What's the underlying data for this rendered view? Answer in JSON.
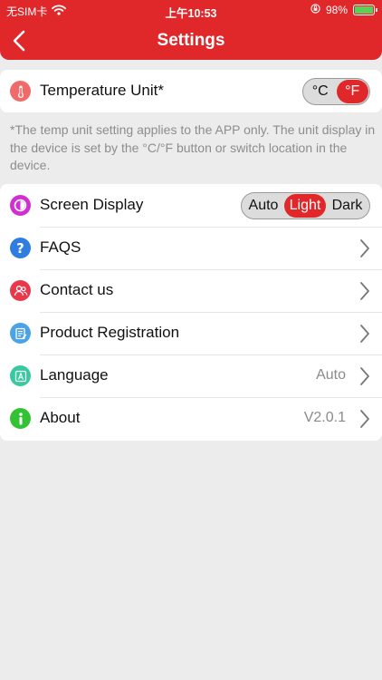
{
  "status_bar": {
    "carrier": "无SIM卡",
    "time": "上午10:53",
    "battery_percent": "98%",
    "battery_level": 0.98
  },
  "nav": {
    "title": "Settings",
    "back_icon": "chevron-left-icon"
  },
  "temperature": {
    "label": "Temperature Unit*",
    "icon": "thermometer-icon",
    "options": [
      "°C",
      "°F"
    ],
    "selected": "°F",
    "note": "*The temp unit setting applies to the APP only. The unit display in the device is set by the °C/°F button or switch location in the device."
  },
  "screen_display": {
    "label": "Screen Display",
    "icon": "brightness-icon",
    "options": [
      "Auto",
      "Light",
      "Dark"
    ],
    "selected": "Light"
  },
  "menu": [
    {
      "label": "FAQS",
      "icon": "question-icon",
      "value": ""
    },
    {
      "label": "Contact us",
      "icon": "contacts-icon",
      "value": ""
    },
    {
      "label": "Product Registration",
      "icon": "registration-icon",
      "value": ""
    },
    {
      "label": "Language",
      "icon": "language-icon",
      "value": "Auto"
    },
    {
      "label": "About",
      "icon": "info-icon",
      "value": "V2.0.1"
    }
  ],
  "colors": {
    "accent": "#e0282b",
    "faqs": "#2f7de1",
    "contact": "#e8384a",
    "registration": "#4aa3e6",
    "language": "#37c9a0",
    "about": "#33c233",
    "screen": "#d12fd1",
    "temperature": "#f06a6a"
  }
}
